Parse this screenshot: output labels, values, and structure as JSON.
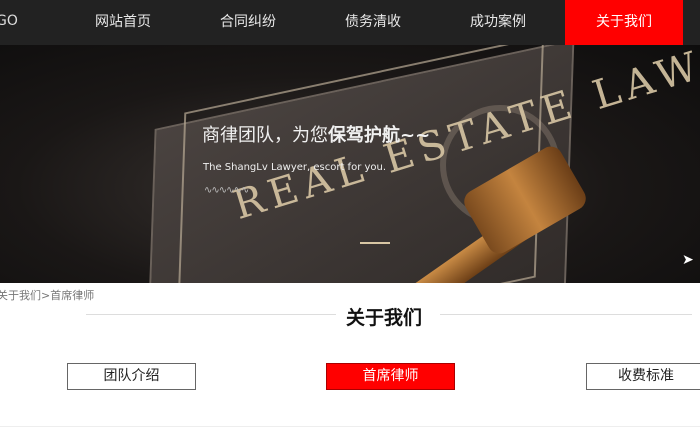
{
  "nav": {
    "logo": "GO",
    "items": [
      {
        "label": "网站首页"
      },
      {
        "label": "合同纠纷"
      },
      {
        "label": "债务清收"
      },
      {
        "label": "成功案例"
      },
      {
        "label": "关于我们",
        "active": true
      }
    ],
    "active_color": "#ff0000"
  },
  "banner": {
    "slogan_normal": "商律团队，为您",
    "slogan_bold": "保驾护航~~",
    "slogan_en": "The ShangLv  Lawyer, escort for you.",
    "decor_text": "REAL ESTATE LAW",
    "wave": "∿∿∿∿∿∿"
  },
  "breadcrumb": "关于我们>首席律师",
  "section": {
    "title": "关于我们",
    "tabs": [
      {
        "label": "团队介绍"
      },
      {
        "label": "首席律师",
        "active": true
      },
      {
        "label": "收费标准"
      }
    ]
  }
}
